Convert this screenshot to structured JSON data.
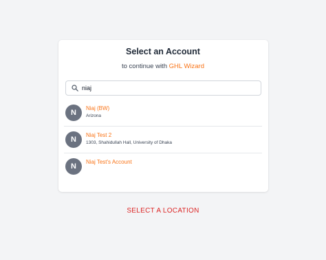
{
  "header": {
    "title": "Select an Account",
    "subtitle_prefix": "to continue with",
    "subtitle_brand": "GHL Wizard"
  },
  "search": {
    "icon": "search-icon",
    "value": "niaj",
    "placeholder": ""
  },
  "accounts": [
    {
      "initial": "N",
      "name": "Niaj (BW)",
      "address": "Arizona"
    },
    {
      "initial": "N",
      "name": "Niaj Test 2",
      "address": "1303, Shahidullah Hall, University of Dhaka"
    },
    {
      "initial": "N",
      "name": "Niaj Test's Account",
      "address": ""
    }
  ],
  "footer": {
    "select_location_label": "SELECT A LOCATION"
  },
  "colors": {
    "accent": "#f97316",
    "avatar_bg": "#6b7280",
    "link_red": "#dc2626",
    "background": "#f3f4f6"
  }
}
